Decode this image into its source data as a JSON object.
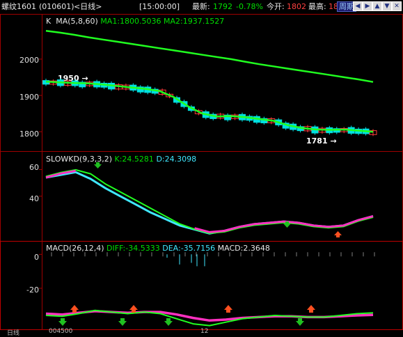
{
  "quote_bar": {
    "name": "螺纹1601",
    "code": "(010601)",
    "period": "<日线>",
    "time": "[15:00:00]",
    "latest_label": "最新:",
    "latest_value": "1792",
    "change_pct": "-0.78%",
    "open_label": "今开:",
    "open_value": "1802",
    "high_label": "最高:",
    "high_value": "18",
    "period_button": "周期",
    "nav_icons": [
      "arrow-left-end-icon",
      "arrow-right-end-icon",
      "arrow-up-icon",
      "arrow-down-icon",
      "close-square-icon"
    ]
  },
  "main_chart": {
    "label": "K",
    "ma_params": "MA(5,8,60)",
    "ma1": "MA1:1800.5036",
    "ma2": "MA2:1937.1527",
    "y_ticks": [
      "2000",
      "1900",
      "1800"
    ],
    "high_callout": "1950 →",
    "low_callout": "1781 →"
  },
  "kd_chart": {
    "title": "SLOWKD(9,3,3,2)",
    "k": "K:24.5281",
    "d": "D:24.3098",
    "y_ticks": [
      "60",
      "40"
    ]
  },
  "macd_chart": {
    "title": "MACD(26,12,4)",
    "diff": "DIFF:-34.5333",
    "dea": "DEA:-35.7156",
    "macd": "MACD:2.3648",
    "y_ticks": [
      "0",
      "-20"
    ]
  },
  "bottom_strip": {
    "left_label": "日线",
    "left_value": "004500",
    "mid_value": "12"
  },
  "colors": {
    "up_candle": "#ff3c3c",
    "down_candle": "#00e0e0",
    "ma_green": "#20ff20",
    "kd_cyan": "#40e8ff",
    "kd_magenta": "#ff30c0",
    "grid_border": "#a00000"
  },
  "chart_data": [
    {
      "type": "line",
      "title": "MA(5,8,60)",
      "y_ticks": [
        2000,
        1900,
        1800
      ],
      "ylim": [
        1760,
        2090
      ],
      "series": [
        {
          "name": "MA2",
          "values": [
            2078,
            2073,
            2067,
            2060,
            2054,
            2048,
            2042,
            2036,
            2030,
            2024,
            2018,
            2012,
            2006,
            2000,
            1993,
            1986,
            1980,
            1974,
            1968,
            1962,
            1956,
            1950,
            1944,
            1937
          ]
        },
        {
          "name": "MA1",
          "values": [
            1938,
            1936,
            1934,
            1933,
            1930,
            1926,
            1922,
            1918,
            1912,
            1895,
            1870,
            1850,
            1842,
            1843,
            1840,
            1835,
            1830,
            1818,
            1810,
            1806,
            1805,
            1806,
            1803,
            1800
          ]
        }
      ]
    },
    {
      "type": "line",
      "title": "SLOWKD(9,3,3,2)",
      "y_ticks": [
        60,
        40
      ],
      "ylim": [
        8,
        66
      ],
      "series": [
        {
          "name": "K",
          "values": [
            54,
            57,
            59,
            56,
            50,
            44,
            38,
            32,
            26,
            20,
            16,
            13,
            14,
            17,
            19,
            20,
            21,
            20,
            18,
            17,
            18,
            22,
            25
          ]
        },
        {
          "name": "D",
          "values": [
            54,
            56,
            58,
            53,
            46,
            40,
            34,
            28,
            23,
            18,
            15,
            12,
            14,
            17,
            19,
            20,
            21,
            20,
            18,
            17,
            18,
            22,
            25
          ]
        }
      ]
    },
    {
      "type": "line",
      "title": "MACD(26,12,4)",
      "y_ticks": [
        0,
        -20
      ],
      "ylim": [
        -43,
        3
      ],
      "series": [
        {
          "name": "DIFF",
          "values": [
            -36,
            -36.5,
            -35,
            -33,
            -34,
            -35,
            -34,
            -35,
            -38,
            -41,
            -42,
            -40,
            -38,
            -37,
            -36,
            -36.5,
            -37,
            -37,
            -36,
            -35,
            -34.5
          ]
        },
        {
          "name": "DEA",
          "values": [
            -35,
            -35.5,
            -34.5,
            -33.5,
            -34,
            -34.5,
            -34,
            -34,
            -35.5,
            -37.5,
            -39,
            -38.5,
            -37.5,
            -37,
            -36.5,
            -36.5,
            -37,
            -37,
            -36.5,
            -36,
            -35.7
          ]
        }
      ]
    }
  ]
}
